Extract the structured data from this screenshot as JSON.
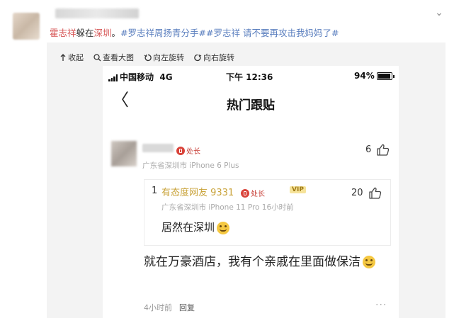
{
  "post": {
    "text_red": "霍志祥",
    "text_1": "躲在",
    "text_location": "深圳",
    "text_2": "。",
    "hashtag_1": "#罗志祥周扬青分手#",
    "hashtag_2": "#罗志祥 请不要再攻击我妈妈了#"
  },
  "toolbar": {
    "collapse": "收起",
    "view_large": "查看大图",
    "rotate_left": "向左旋转",
    "rotate_right": "向右旋转"
  },
  "phone": {
    "carrier": "中国移动",
    "network": "4G",
    "time": "下午 12:36",
    "battery": "94%",
    "nav_title": "热门跟贴",
    "back_glyph": "〈",
    "comment": {
      "badge": "处长",
      "location_device": "广东省深圳市  iPhone 6 Plus",
      "likes": "6",
      "text": "就在万豪酒店，我有个亲戚在里面做保洁",
      "time": "4小时前",
      "reply_label": "回复",
      "more": "···"
    },
    "reply": {
      "index": "1",
      "username": "有态度网友 9331",
      "badge": "处长",
      "vip": "VIP",
      "location_device": "广东省深圳市  iPhone 11 Pro  16小时前",
      "likes": "20",
      "text": "居然在深圳"
    }
  }
}
